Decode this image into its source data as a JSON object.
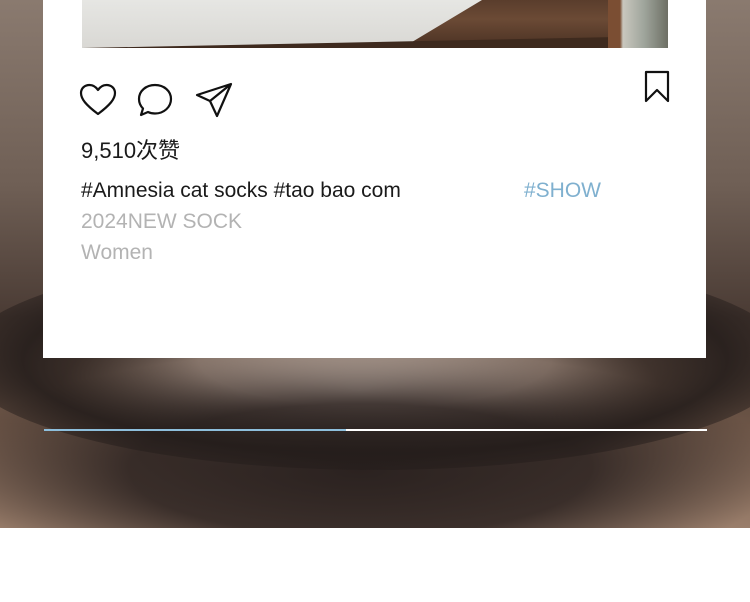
{
  "post": {
    "likes_text": "9,510次赞",
    "caption_tags": [
      "#Amnesia",
      "cat",
      "socks",
      "#tao",
      "bao",
      "com"
    ],
    "caption_text": "#Amnesia cat socks #tao bao com",
    "show_tag": "#SHOW",
    "meta_line1": "2024NEW SOCK",
    "meta_line2": "Women"
  },
  "actions": {
    "icons": [
      "heart-icon",
      "comment-icon",
      "send-icon",
      "bookmark-icon"
    ]
  },
  "carousel": {
    "progress": 0.455
  },
  "colors": {
    "accent": "#7fb0cf",
    "muted": "#b3b3b3",
    "text": "#1a1a1a",
    "progress_fill": "#8ebfdc"
  }
}
